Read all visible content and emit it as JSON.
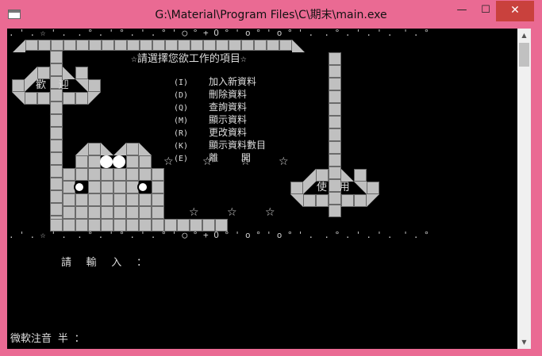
{
  "window": {
    "title": "G:\\Material\\Program Files\\C\\期末\\main.exe",
    "minimize_glyph": "—",
    "maximize_glyph": "☐",
    "close_glyph": "✕"
  },
  "console": {
    "top_dots": ". ' . ☆ ' .  . ° . ' ° . ' . ° ' ◯ ° + O ° ' o ° ' o ° ' .  . ° . ' . ' .  ' . °",
    "bottom_dots": ". ' . ☆ ' .  . ° . ' ° . ' . ° ' ◯ ° + O ° ' o ° ' o ° ' .  . ° . ' . ' .  ' . °",
    "menu_title": "☆請選擇您欲工作的項目☆",
    "menu_items": [
      {
        "key": "(I)",
        "label": "加入新資料"
      },
      {
        "key": "(D)",
        "label": "刪除資料"
      },
      {
        "key": "(Q)",
        "label": "查詢資料"
      },
      {
        "key": "(M)",
        "label": "顯示資料"
      },
      {
        "key": "(R)",
        "label": "更改資料"
      },
      {
        "key": "(K)",
        "label": "顯示資料數目"
      },
      {
        "key": "(E)",
        "label": "離    開"
      }
    ],
    "welcome_text": "歡  迎",
    "use_text": "使  用",
    "prompt": "請  輸  入  ：",
    "ime_status": "微軟注音 半 ：",
    "star_glyph": "☆"
  },
  "colors": {
    "title_bar": "#ea6a93",
    "close_button": "#c9413d",
    "console_bg": "#000000",
    "console_text": "#dddddd",
    "brick": "#c0c0c0"
  }
}
